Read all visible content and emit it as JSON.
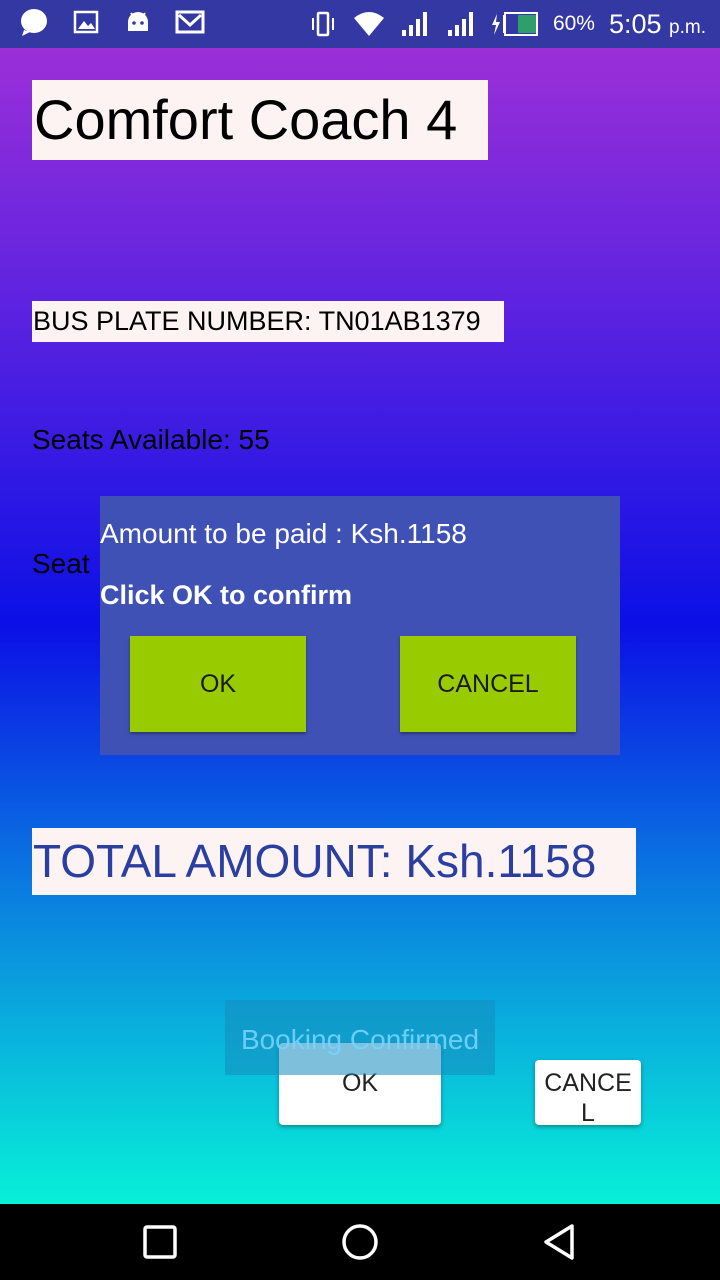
{
  "status_bar": {
    "left_icons": [
      "chat-bubble-icon",
      "image-icon",
      "android-icon",
      "gmail-icon"
    ],
    "right_icons": [
      "vibrate-icon",
      "wifi-icon",
      "signal-icon",
      "signal-icon",
      "charging-battery-icon"
    ],
    "battery": "60%",
    "time": "5:05",
    "ampm": "p.m.",
    "background": "#3338a3"
  },
  "screen": {
    "title": "Comfort Coach 4",
    "plate": "BUS PLATE NUMBER: TN01AB1379",
    "seats_available": "Seats Available: 55",
    "seat_label": "Seat",
    "total_amount": "TOTAL AMOUNT: Ksh.1158",
    "ok_button": "OK",
    "cancel_button": "CANCEL",
    "gradient": [
      "#9b2fd8",
      "#0b10e6",
      "#08f0d8"
    ]
  },
  "toast": {
    "text": "Booking Confirmed"
  },
  "dialog": {
    "message": "Amount to be paid : Ksh.1158",
    "subtitle": "Click OK to confirm",
    "ok_label": "OK",
    "cancel_label": "CANCEL",
    "background": "#3f51b5",
    "button_color": "#99cc00"
  },
  "nav_bar": {
    "buttons": [
      "recents-square-icon",
      "home-circle-icon",
      "back-triangle-icon"
    ]
  }
}
